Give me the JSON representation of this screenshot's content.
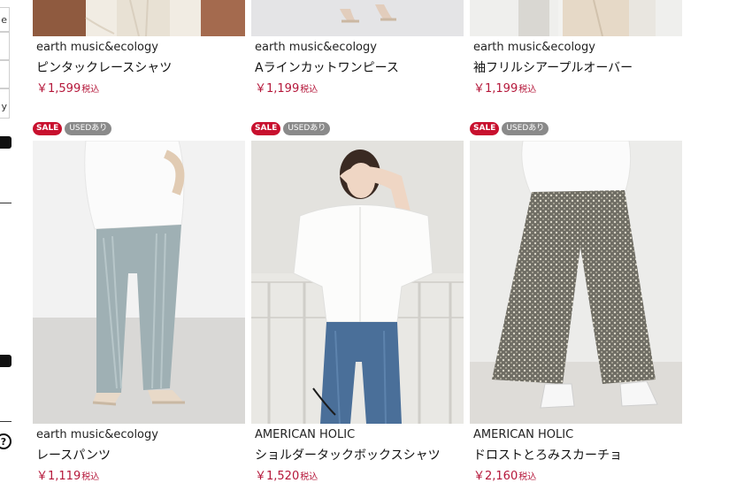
{
  "sidebar": {
    "box_chars": [
      "e",
      "",
      "y"
    ],
    "help_icon": "?"
  },
  "products_top": [
    {
      "brand": "earth music&ecology",
      "name": "ピンタックレースシャツ",
      "price": "￥1,599",
      "tax": "税込"
    },
    {
      "brand": "earth music&ecology",
      "name": "Aラインカットワンピース",
      "price": "￥1,199",
      "tax": "税込"
    },
    {
      "brand": "earth music&ecology",
      "name": "袖フリルシアープルオーバー",
      "price": "￥1,199",
      "tax": "税込"
    }
  ],
  "products_bottom": [
    {
      "badge_sale": "SALE",
      "badge_used": "USEDあり",
      "brand": "earth music&ecology",
      "name": "レースパンツ",
      "price": "￥1,119",
      "tax": "税込"
    },
    {
      "badge_sale": "SALE",
      "badge_used": "USEDあり",
      "brand": "AMERICAN HOLIC",
      "name": "ショルダータックボックスシャツ",
      "price": "￥1,520",
      "tax": "税込"
    },
    {
      "badge_sale": "SALE",
      "badge_used": "USEDあり",
      "brand": "AMERICAN HOLIC",
      "name": "ドロストとろみスカーチョ",
      "price": "￥2,160",
      "tax": "税込"
    }
  ],
  "colors": {
    "price": "#b5173a",
    "sale_badge": "#c8102e",
    "used_badge": "#8a8a8a"
  }
}
